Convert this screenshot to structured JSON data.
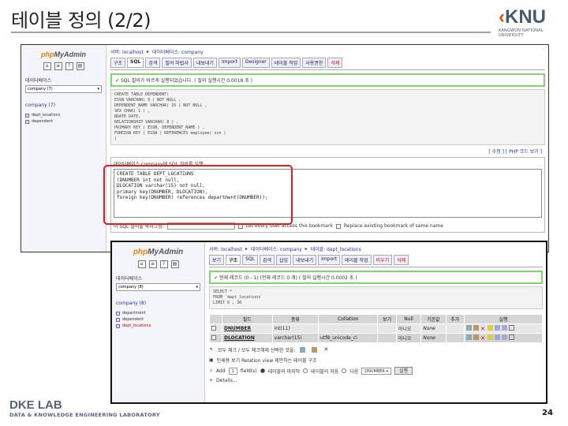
{
  "slide": {
    "title": "테이블 정의 (2/2)",
    "page_number": "24",
    "logo_text": "KNU",
    "logo_sub1": "KANGWON NATIONAL",
    "logo_sub2": "UNIVERSITY",
    "footer_title": "DKE LAB",
    "footer_sub": "DATA & KNOWLEDGE ENGINEERING LABORATORY"
  },
  "shot1": {
    "sidebar": {
      "brand_left": "php",
      "brand_right": "MyAdmin",
      "db_label": "데이터베이스",
      "db_select": "company (7)",
      "db_name": "company (7)",
      "tables": [
        "dept_locations",
        "dependent"
      ]
    },
    "breadcrumb": {
      "server": "서버: localhost",
      "database": "데이터베이스: company"
    },
    "tabs": [
      "구조",
      "SQL",
      "검색",
      "질의 마법사",
      "내보내기",
      "Import",
      "Designer",
      "테이블 작업",
      "사용권한",
      "삭제"
    ],
    "success_msg": "SQL 질의가 바르게 실행되었습니다. ( 질의 실행시간 0.0018 초 )",
    "sql_lines": [
      "CREATE TABLE DEPENDENT(",
      "ESSN VARCHAR( 9 ) NOT NULL ,",
      "DEPENDENT_NAME VARCHAR( 15 ) NOT NULL ,",
      "SEX CHAR( 1 ) ,",
      "BDATE DATE,",
      "RELATIONSHIP VARCHAR( 8 ) ,",
      "PRIMARY KEY ( ESSN, DEPENDENT_NAME ) ,",
      "FOREIGN KEY ( ESSN ) REFERENCES employee( ssn )",
      ")"
    ],
    "edit_link": "[ 수정 ] [ PHP 코드 보기 ]",
    "query_legend": "데이터베이스 company에 SQL 질의를 실행:",
    "query_lines": [
      "CREATE TABLE DEPT_LOCATIONS",
      "(DNUMBER int not null,",
      "DLOCATION varchar(15) not null,",
      "primary key(DNUMBER, DLOCATION),",
      "foreign key(DNUMBER) references department(DNUMBER));"
    ],
    "bookmark_label": "이 SQL 질의를 북마크함:",
    "bookmark_opt1": "Let every user access this bookmark",
    "bookmark_opt2": "Replace existing bookmark of same name"
  },
  "shot2": {
    "sidebar": {
      "brand_left": "php",
      "brand_right": "MyAdmin",
      "db_label": "데이터베이스",
      "db_select": "company (8)",
      "db_name": "company (8)",
      "tables": [
        "department",
        "dependent",
        "dept_locations"
      ]
    },
    "breadcrumb": {
      "server": "서버: localhost",
      "database": "데이터베이스: company",
      "table": "테이블: dept_locations"
    },
    "tabs": [
      "보기",
      "구조",
      "SQL",
      "검색",
      "삽입",
      "내보내기",
      "Import",
      "테이블 작업",
      "비우기",
      "삭제"
    ],
    "success_msg": "현재 레코드 (0 - 1) (전체 레코드 0 개) ( 질의 실행시간 0.0002 초 )",
    "sql_lines": [
      "SELECT *",
      "FROM `dept_locations`",
      "LIMIT 0 , 30"
    ],
    "columns": [
      "필드",
      "종류",
      "Collation",
      "보기",
      "Null",
      "기본값",
      "추가",
      "실행"
    ],
    "rows": [
      {
        "field": "DNUMBER",
        "type": "int(11)",
        "collation": "",
        "attr": "",
        "null": "아니오",
        "default": "None",
        "extra": ""
      },
      {
        "field": "DLOCATION",
        "type": "varchar(15)",
        "collation": "utf8_unicode_ci",
        "attr": "",
        "null": "아니오",
        "default": "None",
        "extra": ""
      }
    ],
    "check_all": "모두 체크 / 모두 체크해제 선택한 것을:",
    "more1": "인쇄용 보기   Relation view   제안하는 테이블 구조",
    "more2_prefix": "Add",
    "more2_count": "1",
    "more2_mid": "field(s)",
    "more2_opt1": "테이블의 마지막",
    "more2_opt2": "테이블의 처음",
    "more2_opt3": "다음",
    "more2_select": "DNUMBER",
    "go": "실행",
    "details": "Details..."
  }
}
